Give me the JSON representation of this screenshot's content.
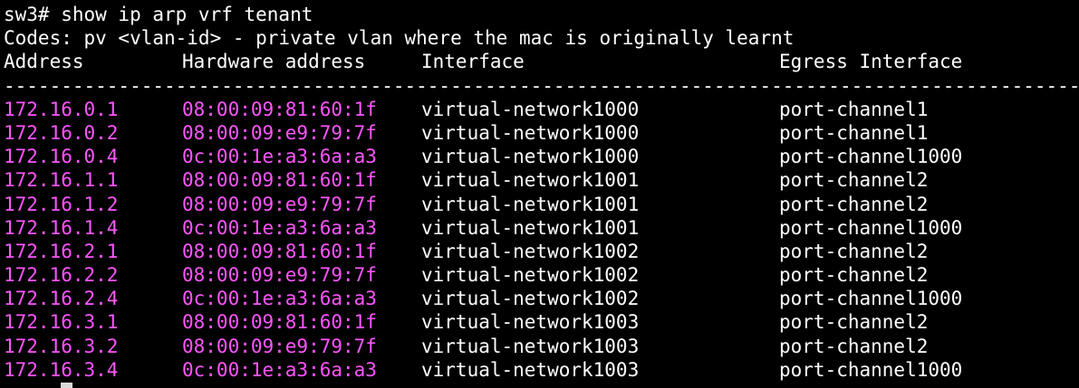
{
  "prompt_line": "sw3# show ip arp vrf tenant",
  "codes_line": "Codes: pv <vlan-id> - private vlan where the mac is originally learnt",
  "headers": {
    "address": "Address",
    "hardware": "Hardware address",
    "interface": "Interface",
    "egress": "Egress Interface"
  },
  "separator": "------------------------------------------------------------------------------------------------------------------------",
  "rows": [
    {
      "address": "172.16.0.1",
      "hardware": "08:00:09:81:60:1f",
      "interface": "virtual-network1000",
      "egress": "port-channel1"
    },
    {
      "address": "172.16.0.2",
      "hardware": "08:00:09:e9:79:7f",
      "interface": "virtual-network1000",
      "egress": "port-channel1"
    },
    {
      "address": "172.16.0.4",
      "hardware": "0c:00:1e:a3:6a:a3",
      "interface": "virtual-network1000",
      "egress": "port-channel1000"
    },
    {
      "address": "172.16.1.1",
      "hardware": "08:00:09:81:60:1f",
      "interface": "virtual-network1001",
      "egress": "port-channel2"
    },
    {
      "address": "172.16.1.2",
      "hardware": "08:00:09:e9:79:7f",
      "interface": "virtual-network1001",
      "egress": "port-channel2"
    },
    {
      "address": "172.16.1.4",
      "hardware": "0c:00:1e:a3:6a:a3",
      "interface": "virtual-network1001",
      "egress": "port-channel1000"
    },
    {
      "address": "172.16.2.1",
      "hardware": "08:00:09:81:60:1f",
      "interface": "virtual-network1002",
      "egress": "port-channel2"
    },
    {
      "address": "172.16.2.2",
      "hardware": "08:00:09:e9:79:7f",
      "interface": "virtual-network1002",
      "egress": "port-channel2"
    },
    {
      "address": "172.16.2.4",
      "hardware": "0c:00:1e:a3:6a:a3",
      "interface": "virtual-network1002",
      "egress": "port-channel1000"
    },
    {
      "address": "172.16.3.1",
      "hardware": "08:00:09:81:60:1f",
      "interface": "virtual-network1003",
      "egress": "port-channel2"
    },
    {
      "address": "172.16.3.2",
      "hardware": "08:00:09:e9:79:7f",
      "interface": "virtual-network1003",
      "egress": "port-channel2"
    },
    {
      "address": "172.16.3.4",
      "hardware": "0c:00:1e:a3:6a:a3",
      "interface": "virtual-network1003",
      "egress": "port-channel1000"
    }
  ],
  "colors": {
    "background": "#000000",
    "text": "#ffffff",
    "highlight": "#ff55ff",
    "cursor": "#d9d9d9"
  }
}
